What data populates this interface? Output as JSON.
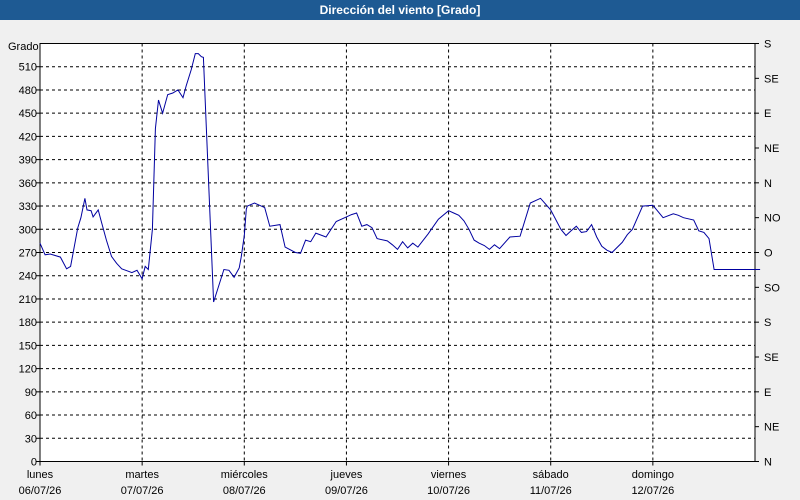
{
  "window": {
    "title": "Dirección del viento [Grado]"
  },
  "chart_data": {
    "type": "line",
    "title": "Dirección del viento [Grado]",
    "ylabel": "Grado",
    "ylim": [
      0,
      540
    ],
    "yticks": [
      0,
      30,
      60,
      90,
      120,
      150,
      180,
      210,
      240,
      270,
      300,
      330,
      360,
      390,
      420,
      450,
      480,
      510
    ],
    "y2ticks": [
      "N",
      "NE",
      "E",
      "SE",
      "S",
      "SO",
      "O",
      "NO",
      "N",
      "NE",
      "E",
      "SE",
      "S"
    ],
    "x_days": [
      {
        "day": "lunes",
        "date": "06/07/26"
      },
      {
        "day": "martes",
        "date": "07/07/26"
      },
      {
        "day": "miércoles",
        "date": "08/07/26"
      },
      {
        "day": "jueves",
        "date": "09/07/26"
      },
      {
        "day": "viernes",
        "date": "10/07/26"
      },
      {
        "day": "sábado",
        "date": "11/07/26"
      },
      {
        "day": "domingo",
        "date": "12/07/26"
      }
    ],
    "grid": true,
    "line_color": "#0000a0",
    "series": [
      {
        "x": [
          0,
          0.05,
          0.1,
          0.2,
          0.26,
          0.3,
          0.37,
          0.4,
          0.44,
          0.46,
          0.5,
          0.52,
          0.57,
          0.6,
          0.65,
          0.7,
          0.75,
          0.8,
          0.9,
          0.95,
          1.0,
          1.03,
          1.06,
          1.1,
          1.13,
          1.16,
          1.2,
          1.25,
          1.3,
          1.35,
          1.4,
          1.43,
          1.48,
          1.52,
          1.55,
          1.58,
          1.6,
          1.7,
          1.8,
          1.85,
          1.9,
          1.95,
          1.97,
          2.0,
          2.02,
          2.03,
          2.1,
          2.2,
          2.25,
          2.35,
          2.4,
          2.5,
          2.55,
          2.6,
          2.65,
          2.7,
          2.8,
          2.9,
          3.0,
          3.05,
          3.1,
          3.15,
          3.2,
          3.25,
          3.3,
          3.4,
          3.45,
          3.5,
          3.55,
          3.6,
          3.65,
          3.7,
          3.8,
          3.9,
          4.0,
          4.05,
          4.1,
          4.15,
          4.2,
          4.25,
          4.3,
          4.35,
          4.4,
          4.45,
          4.5,
          4.6,
          4.7,
          4.8,
          4.9,
          5.0,
          5.1,
          5.15,
          5.2,
          5.25,
          5.3,
          5.35,
          5.4,
          5.45,
          5.5,
          5.55,
          5.6,
          5.7,
          5.75,
          5.8,
          5.9,
          6.0,
          6.1,
          6.2,
          6.25,
          6.3,
          6.4,
          6.45,
          6.5,
          6.55,
          6.6,
          6.65,
          6.7,
          6.75,
          6.8,
          6.9,
          6.95,
          7.0,
          7.05
        ],
        "y": [
          282,
          267,
          268,
          264,
          249,
          252,
          302,
          315,
          340,
          325,
          324,
          316,
          325,
          310,
          286,
          265,
          256,
          249,
          244,
          247,
          236,
          252,
          248,
          300,
          430,
          467,
          450,
          474,
          476,
          480,
          470,
          485,
          506,
          527,
          527,
          523,
          522,
          206,
          248,
          247,
          238,
          250,
          264,
          292,
          326,
          330,
          334,
          328,
          304,
          306,
          277,
          270,
          269,
          286,
          284,
          295,
          290,
          310,
          316,
          319,
          321,
          304,
          306,
          302,
          288,
          285,
          280,
          274,
          284,
          276,
          282,
          277,
          294,
          313,
          324,
          321,
          318,
          311,
          300,
          286,
          282,
          279,
          274,
          280,
          275,
          290,
          291,
          334,
          340,
          325,
          300,
          292,
          298,
          304,
          296,
          297,
          306,
          290,
          278,
          273,
          270,
          283,
          293,
          300,
          330,
          331,
          315,
          320,
          318,
          315,
          312,
          298,
          296,
          288,
          248,
          248,
          248,
          248,
          248,
          248,
          248,
          248,
          248
        ]
      }
    ]
  }
}
